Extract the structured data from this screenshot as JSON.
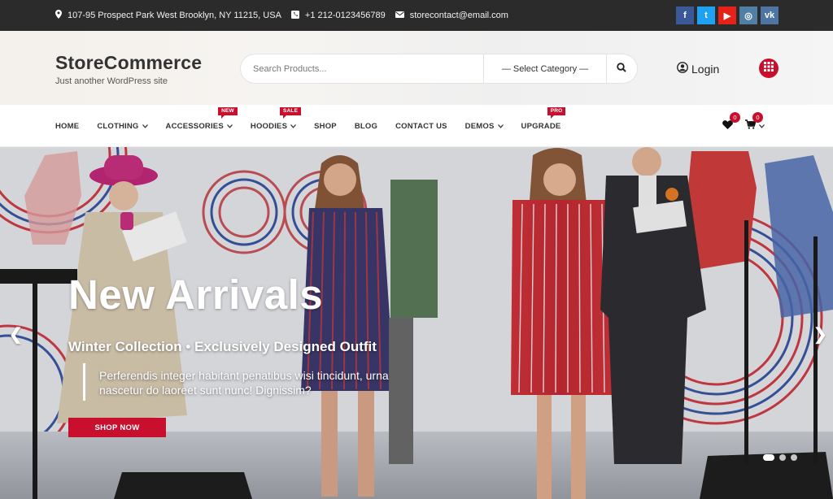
{
  "topbar": {
    "address": "107-95 Prospect Park West Brooklyn, NY 11215, USA",
    "phone": "+1 212-0123456789",
    "email": "storecontact@email.com",
    "social": [
      {
        "name": "facebook",
        "glyph": "f",
        "color": "#3b5998"
      },
      {
        "name": "twitter",
        "glyph": "t",
        "color": "#1da1f2"
      },
      {
        "name": "youtube",
        "glyph": "▶",
        "color": "#e62117"
      },
      {
        "name": "instagram",
        "glyph": "◎",
        "color": "#517fa4"
      },
      {
        "name": "vk",
        "glyph": "vk",
        "color": "#4c75a3"
      }
    ]
  },
  "header": {
    "site_name": "StoreCommerce",
    "tagline": "Just another WordPress site",
    "search_placeholder": "Search Products...",
    "category_select": "— Select Category —",
    "login_label": "Login"
  },
  "nav": {
    "items": [
      {
        "label": "HOME"
      },
      {
        "label": "CLOTHING",
        "dropdown": true
      },
      {
        "label": "ACCESSORIES",
        "dropdown": true,
        "badge": "NEW"
      },
      {
        "label": "HOODIES",
        "dropdown": true,
        "badge": "SALE"
      },
      {
        "label": "SHOP"
      },
      {
        "label": "BLOG"
      },
      {
        "label": "CONTACT US"
      },
      {
        "label": "DEMOS",
        "dropdown": true
      },
      {
        "label": "UPGRADE",
        "badge": "PRO"
      }
    ],
    "wishlist_count": "0",
    "cart_count": "0"
  },
  "hero": {
    "title": "New Arrivals",
    "subtitle": "Winter Collection • Exclusively Designed Outfit",
    "description": "Perferendis integer habitant penatibus wisi tincidunt, urna nascetur do laoreet sunt nunc! Dignissim?",
    "button": "SHOP NOW",
    "prev_arrow": "❮",
    "next_arrow": "❯",
    "slides": 3,
    "active_slide": 1
  },
  "colors": {
    "accent": "#c8102e",
    "topbar": "#2b2b2b"
  }
}
